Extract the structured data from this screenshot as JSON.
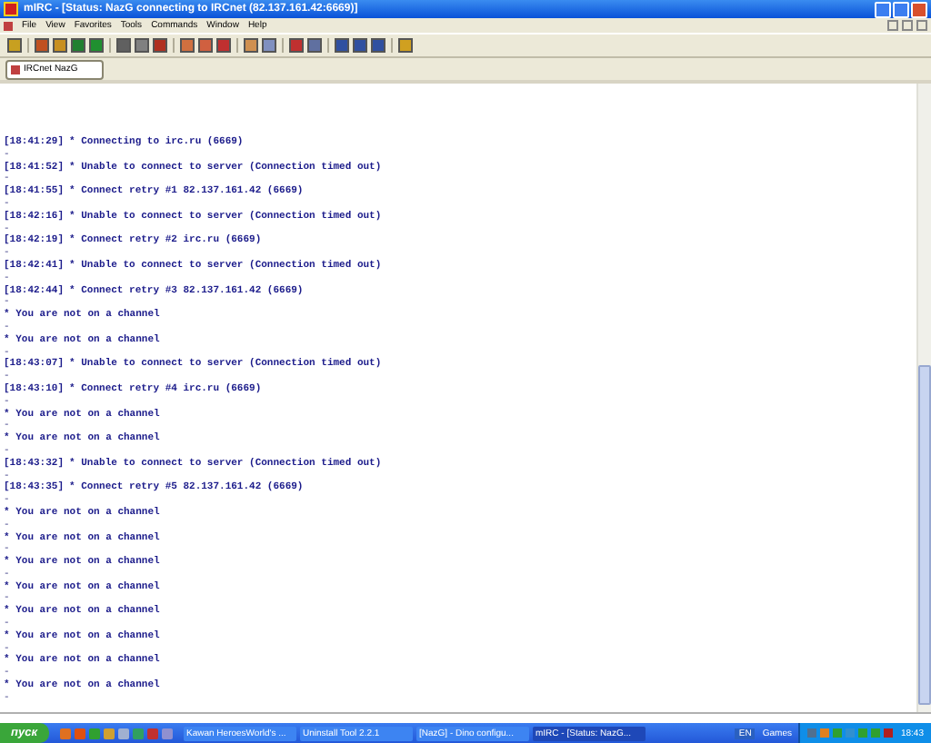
{
  "window": {
    "title": "mIRC - [Status: NazG connecting to IRCnet (82.137.161.42:6669)]"
  },
  "menu": [
    "File",
    "View",
    "Favorites",
    "Tools",
    "Commands",
    "Window",
    "Help"
  ],
  "switchbar": [
    {
      "label": "IRCnet NazG",
      "selected": true
    }
  ],
  "messages": [
    {
      "time": "[18:41:29]",
      "text": "* Connecting to irc.ru (6669)",
      "after": "-"
    },
    {
      "time": "[18:41:52]",
      "text": "* Unable to connect to server (Connection timed out)",
      "after": "-"
    },
    {
      "time": "[18:41:55]",
      "text": "* Connect retry #1 82.137.161.42 (6669)",
      "after": "-"
    },
    {
      "time": "[18:42:16]",
      "text": "* Unable to connect to server (Connection timed out)",
      "after": "-"
    },
    {
      "time": "[18:42:19]",
      "text": "* Connect retry #2 irc.ru (6669)",
      "after": "-"
    },
    {
      "time": "[18:42:41]",
      "text": "* Unable to connect to server (Connection timed out)",
      "after": "-"
    },
    {
      "time": "[18:42:44]",
      "text": "* Connect retry #3 82.137.161.42 (6669)",
      "after": "-"
    },
    {
      "text": "* You are not on a channel",
      "after": "-"
    },
    {
      "text": "* You are not on a channel",
      "after": "-"
    },
    {
      "time": "[18:43:07]",
      "text": "* Unable to connect to server (Connection timed out)",
      "after": "-"
    },
    {
      "time": "[18:43:10]",
      "text": "* Connect retry #4 irc.ru (6669)",
      "after": "-"
    },
    {
      "text": "* You are not on a channel",
      "after": "-"
    },
    {
      "text": "* You are not on a channel",
      "after": "-"
    },
    {
      "time": "[18:43:32]",
      "text": "* Unable to connect to server (Connection timed out)",
      "after": "-"
    },
    {
      "time": "[18:43:35]",
      "text": "* Connect retry #5 82.137.161.42 (6669)",
      "after": "-"
    },
    {
      "text": "* You are not on a channel",
      "after": "-"
    },
    {
      "text": "* You are not on a channel",
      "after": "-"
    },
    {
      "text": "* You are not on a channel",
      "after": "-"
    },
    {
      "text": "* You are not on a channel",
      "after": "-"
    },
    {
      "text": "* You are not on a channel",
      "after": "-"
    },
    {
      "text": "* You are not on a channel",
      "after": "-"
    },
    {
      "text": "* You are not on a channel",
      "after": "-"
    },
    {
      "text": "* You are not on a channel",
      "after": "-"
    }
  ],
  "taskbar": {
    "start": "пуск",
    "tasks": [
      {
        "label": "Kawan HeroesWorld's ...",
        "selected": false
      },
      {
        "label": "Uninstall Tool 2.2.1",
        "selected": false
      },
      {
        "label": "[NazG] - Dino configu...",
        "selected": false
      },
      {
        "label": "mIRC - [Status: NazG...",
        "selected": true
      }
    ],
    "language": "EN",
    "toolbar": "Games",
    "clock": "18:43"
  }
}
